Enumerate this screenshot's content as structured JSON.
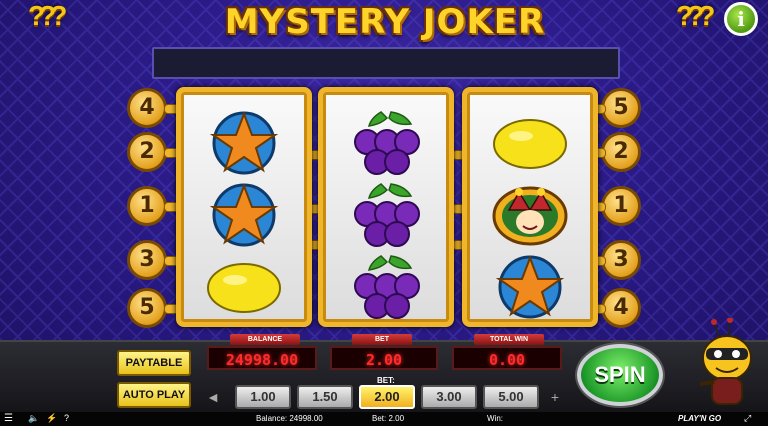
{
  "game": {
    "title": "MYSTERY JOKER",
    "corner_glyph": "???",
    "info_label": "i"
  },
  "paylines_left": [
    "4",
    "2",
    "1",
    "3",
    "5"
  ],
  "paylines_right": [
    "5",
    "2",
    "1",
    "3",
    "4"
  ],
  "reels": [
    [
      "star",
      "star",
      "lemon"
    ],
    [
      "plum",
      "plum",
      "plum"
    ],
    [
      "lemon",
      "joker",
      "star"
    ]
  ],
  "controls": {
    "paytable_label": "PAYTABLE",
    "autoplay_label": "AUTO PLAY",
    "balance_label": "BALANCE",
    "balance_value": "24998.00",
    "bet_label": "BET",
    "bet_value": "2.00",
    "total_win_label": "TOTAL WIN",
    "total_win_value": "0.00",
    "bet_selector_label": "BET:",
    "bet_options": [
      "1.00",
      "1.50",
      "2.00",
      "3.00",
      "5.00"
    ],
    "selected_bet": "2.00",
    "decrease_label": "◄",
    "increase_label": "+",
    "spin_label": "SPIN"
  },
  "status_bar": {
    "balance_text": "Balance: 24998.00",
    "bet_text": "Bet: 2.00",
    "win_text": "Win:",
    "brand": "PLAY'N GO"
  },
  "colors": {
    "gold": "#f0b62b",
    "lcd_red": "#ff2a2a",
    "spin_green": "#1f9a2a"
  }
}
